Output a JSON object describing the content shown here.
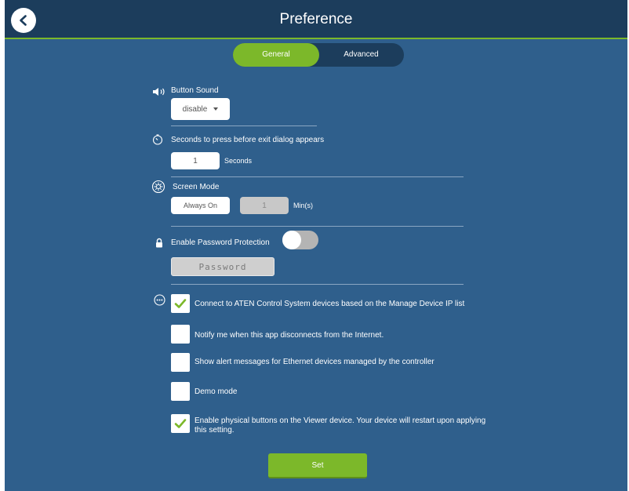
{
  "header": {
    "title": "Preference"
  },
  "tabs": [
    {
      "label": "General",
      "active": true
    },
    {
      "label": "Advanced",
      "active": false
    }
  ],
  "button_sound": {
    "label": "Button Sound",
    "value": "disable"
  },
  "exit_dialog": {
    "label": "Seconds to press before exit dialog appears",
    "value": "1",
    "unit": "Seconds"
  },
  "screen_mode": {
    "label": "Screen Mode",
    "mode": "Always On",
    "minutes": "1",
    "unit": "Min(s)"
  },
  "password": {
    "label": "Enable Password Protection",
    "enabled": false,
    "placeholder": "Password"
  },
  "options": [
    {
      "label": "Connect to ATEN Control System devices based on the Manage Device IP list",
      "checked": true
    },
    {
      "label": "Notify me when this app disconnects from the Internet.",
      "checked": false
    },
    {
      "label": "Show alert messages for Ethernet devices managed by the controller",
      "checked": false
    },
    {
      "label": "Demo mode",
      "checked": false
    },
    {
      "label": "Enable physical buttons on the Viewer device. Your device will restart upon applying this setting.",
      "checked": true
    }
  ],
  "set_button": {
    "label": "Set"
  },
  "colors": {
    "background": "#2f5f8c",
    "header": "#1c3d5c",
    "accent": "#7cb82a"
  }
}
